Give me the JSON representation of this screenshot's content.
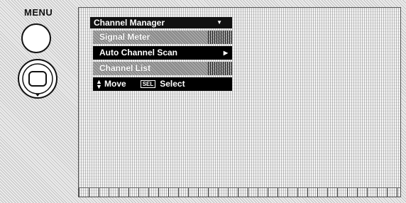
{
  "remote": {
    "menu_label": "MENU"
  },
  "osd": {
    "title": "Channel Manager",
    "items": [
      {
        "label": "Signal Meter",
        "state": "disabled"
      },
      {
        "label": "Auto Channel Scan",
        "state": "selected"
      },
      {
        "label": "Channel List",
        "state": "disabled"
      }
    ],
    "footer": {
      "move_label": "Move",
      "sel_key": "SEL",
      "select_label": "Select"
    }
  },
  "icons": [
    "menu-button-icon",
    "dpad-icon",
    "dropdown-arrow-icon",
    "submenu-arrow-icon",
    "up-down-arrows-icon"
  ],
  "colors": {
    "osd_background": "#000000",
    "osd_text": "#ffffff",
    "disabled_item": "#8a8a8a"
  }
}
